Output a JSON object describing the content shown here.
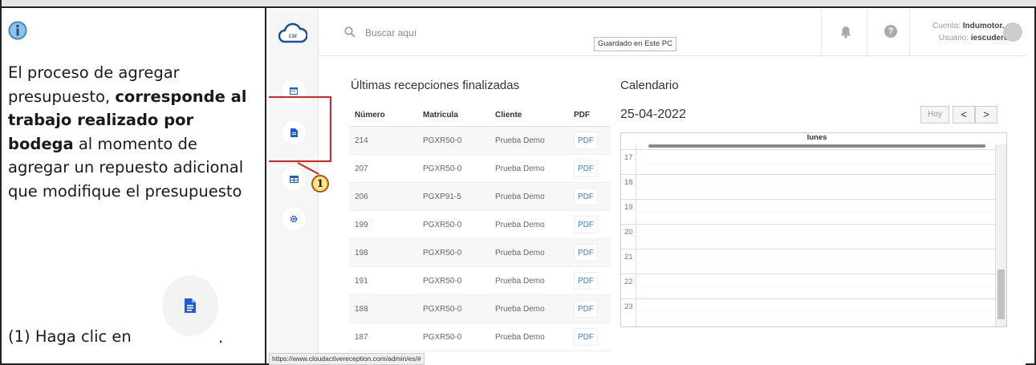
{
  "doc": {
    "paragraph": {
      "part1": "El proceso de agregar presupuesto, ",
      "bold": "corresponde al trabajo realizado por bodega",
      "part2": " al momento de agregar un repuesto adicional que modifique el presupuesto"
    },
    "step_text": "(1) Haga clic en",
    "step_dot": ".",
    "info_icon": "info-icon"
  },
  "app": {
    "logo_text": "car",
    "search_placeholder": "Buscar aquí",
    "saved_tooltip": "Guardado en Este PC",
    "account_label": "Cuenta:",
    "account_value": "Indumotor...",
    "user_label": "Usuario:",
    "user_value": "iescudero",
    "sidebar": [
      "calendar-icon",
      "document-icon",
      "grid-icon",
      "gear-icon"
    ],
    "callout_number": "1",
    "status_url": "https://www.cloudactivereception.com/admin/es/#"
  },
  "receptions": {
    "title": "Últimas recepciones finalizadas",
    "columns": [
      "Número",
      "Matrícula",
      "Cliente",
      "PDF"
    ],
    "rows": [
      [
        "214",
        "PGXR50-0",
        "Prueba Demo",
        "PDF"
      ],
      [
        "207",
        "PGXR50-0",
        "Prueba Demo",
        "PDF"
      ],
      [
        "206",
        "PGXP91-5",
        "Prueba Demo",
        "PDF"
      ],
      [
        "199",
        "PGXR50-0",
        "Prueba Demo",
        "PDF"
      ],
      [
        "198",
        "PGXR50-0",
        "Prueba Demo",
        "PDF"
      ],
      [
        "191",
        "PGXR50-0",
        "Prueba Demo",
        "PDF"
      ],
      [
        "188",
        "PGXR50-0",
        "Prueba Demo",
        "PDF"
      ],
      [
        "187",
        "PGXR50-0",
        "Prueba Demo",
        "PDF"
      ]
    ]
  },
  "calendar": {
    "title": "Calendario",
    "date": "25-04-2022",
    "today_label": "Hoy",
    "prev_label": "<",
    "next_label": ">",
    "day_header": "lunes",
    "hours": [
      "17",
      "18",
      "19",
      "20",
      "21",
      "22",
      "23"
    ]
  },
  "colors": {
    "highlight": "#dd2222",
    "accent_blue": "#3b82c4"
  }
}
